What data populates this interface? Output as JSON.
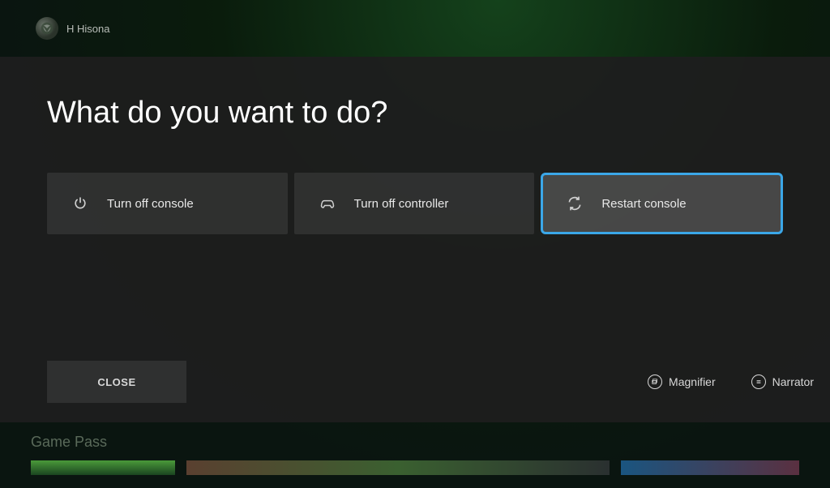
{
  "header": {
    "username": "H Hisona"
  },
  "dialog": {
    "title": "What do you want to do?",
    "options": [
      {
        "label": "Turn off console",
        "icon": "power",
        "focused": false
      },
      {
        "label": "Turn off controller",
        "icon": "controller",
        "focused": false
      },
      {
        "label": "Restart console",
        "icon": "restart",
        "focused": true
      }
    ],
    "close_label": "CLOSE",
    "accessibility": {
      "magnifier_label": "Magnifier",
      "narrator_label": "Narrator"
    }
  },
  "bottom": {
    "section_label": "Game Pass"
  }
}
